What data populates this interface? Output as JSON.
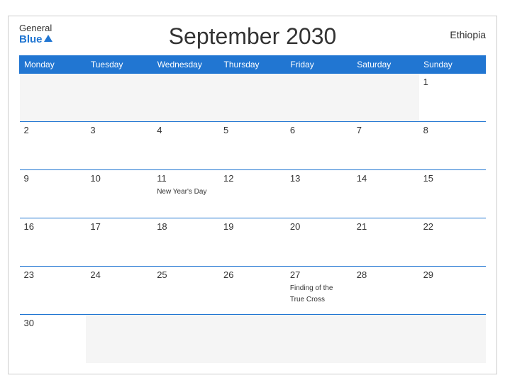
{
  "brand": {
    "general": "General",
    "blue": "Blue",
    "triangle": true
  },
  "header": {
    "title": "September 2030",
    "country": "Ethiopia"
  },
  "weekdays": [
    "Monday",
    "Tuesday",
    "Wednesday",
    "Thursday",
    "Friday",
    "Saturday",
    "Sunday"
  ],
  "weeks": [
    [
      {
        "day": "",
        "empty": true
      },
      {
        "day": "",
        "empty": true
      },
      {
        "day": "",
        "empty": true
      },
      {
        "day": "",
        "empty": true
      },
      {
        "day": "",
        "empty": true
      },
      {
        "day": "",
        "empty": true
      },
      {
        "day": "1",
        "empty": false,
        "event": ""
      }
    ],
    [
      {
        "day": "2",
        "empty": false,
        "event": ""
      },
      {
        "day": "3",
        "empty": false,
        "event": ""
      },
      {
        "day": "4",
        "empty": false,
        "event": ""
      },
      {
        "day": "5",
        "empty": false,
        "event": ""
      },
      {
        "day": "6",
        "empty": false,
        "event": ""
      },
      {
        "day": "7",
        "empty": false,
        "event": ""
      },
      {
        "day": "8",
        "empty": false,
        "event": ""
      }
    ],
    [
      {
        "day": "9",
        "empty": false,
        "event": ""
      },
      {
        "day": "10",
        "empty": false,
        "event": ""
      },
      {
        "day": "11",
        "empty": false,
        "event": "New Year's Day"
      },
      {
        "day": "12",
        "empty": false,
        "event": ""
      },
      {
        "day": "13",
        "empty": false,
        "event": ""
      },
      {
        "day": "14",
        "empty": false,
        "event": ""
      },
      {
        "day": "15",
        "empty": false,
        "event": ""
      }
    ],
    [
      {
        "day": "16",
        "empty": false,
        "event": ""
      },
      {
        "day": "17",
        "empty": false,
        "event": ""
      },
      {
        "day": "18",
        "empty": false,
        "event": ""
      },
      {
        "day": "19",
        "empty": false,
        "event": ""
      },
      {
        "day": "20",
        "empty": false,
        "event": ""
      },
      {
        "day": "21",
        "empty": false,
        "event": ""
      },
      {
        "day": "22",
        "empty": false,
        "event": ""
      }
    ],
    [
      {
        "day": "23",
        "empty": false,
        "event": ""
      },
      {
        "day": "24",
        "empty": false,
        "event": ""
      },
      {
        "day": "25",
        "empty": false,
        "event": ""
      },
      {
        "day": "26",
        "empty": false,
        "event": ""
      },
      {
        "day": "27",
        "empty": false,
        "event": "Finding of the True Cross"
      },
      {
        "day": "28",
        "empty": false,
        "event": ""
      },
      {
        "day": "29",
        "empty": false,
        "event": ""
      }
    ],
    [
      {
        "day": "30",
        "empty": false,
        "event": ""
      },
      {
        "day": "",
        "empty": true
      },
      {
        "day": "",
        "empty": true
      },
      {
        "day": "",
        "empty": true
      },
      {
        "day": "",
        "empty": true
      },
      {
        "day": "",
        "empty": true
      },
      {
        "day": "",
        "empty": true
      }
    ]
  ]
}
